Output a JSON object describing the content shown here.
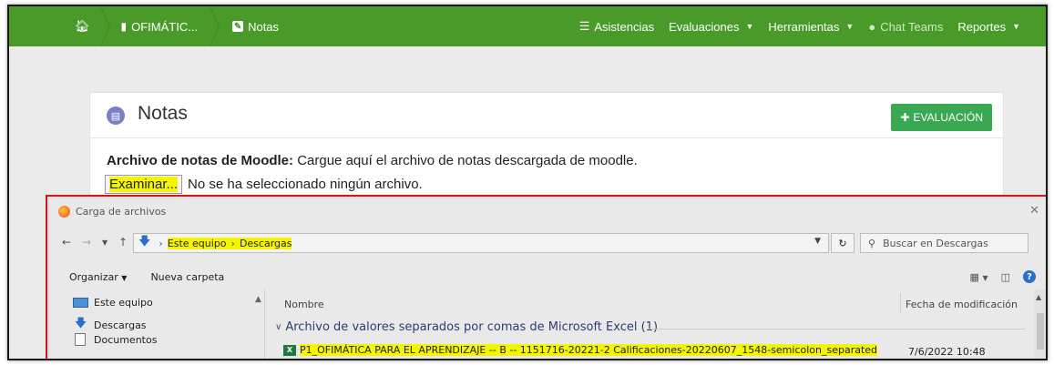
{
  "navbar": {
    "breadcrumbs": [
      {
        "label": "",
        "icon": "home-icon"
      },
      {
        "label": "OFIMÁTIC...",
        "icon": "book-icon"
      },
      {
        "label": "Notas",
        "icon": "edit-icon"
      }
    ],
    "menu": [
      {
        "label": "Asistencias",
        "icon": "bars-icon"
      },
      {
        "label": "Evaluaciones",
        "caret": true
      },
      {
        "label": "Herramientas",
        "caret": true
      },
      {
        "label": "Chat Teams",
        "icon": "chat-icon"
      },
      {
        "label": "Reportes",
        "caret": true
      }
    ],
    "color": "#4a9a2a"
  },
  "card": {
    "title": "Notas",
    "eval_button": "EVALUACIÓN",
    "file_label_bold": "Archivo de notas de Moodle:",
    "file_label_text": " Cargue aquí el archivo de notas descargada de moodle.",
    "browse_button": "Examinar...",
    "no_file_text": "No se ha seleccionado ningún archivo."
  },
  "dialog": {
    "title": "Carga de archivos",
    "path": [
      "Este equipo",
      "Descargas"
    ],
    "search_placeholder": "Buscar en Descargas",
    "toolbar": {
      "organize": "Organizar",
      "new_folder": "Nueva carpeta"
    },
    "nav": [
      "Este equipo",
      "Descargas",
      "Documentos"
    ],
    "columns": {
      "name": "Nombre",
      "date": "Fecha de modificación"
    },
    "group_label": "Archivo de valores separados por comas de Microsoft Excel (1)",
    "file": {
      "name": "P1_OFIMÁTICA PARA EL APRENDIZAJE -- B -- 1151716-20221-2 Calificaciones-20220607_1548-semicolon_separated",
      "date": "7/6/2022 10:48"
    }
  }
}
